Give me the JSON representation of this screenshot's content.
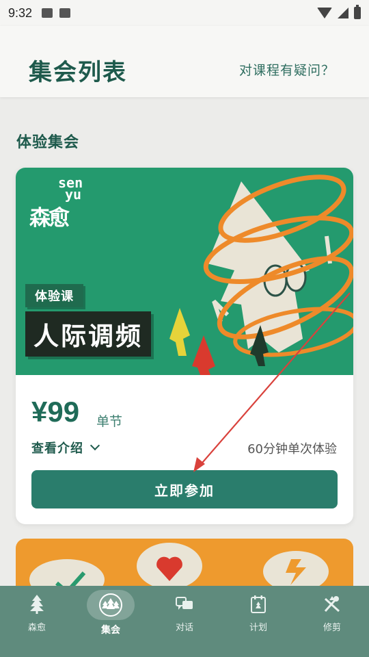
{
  "status_bar": {
    "time": "9:32"
  },
  "header": {
    "title": "集会列表",
    "help_link": "对课程有疑问？"
  },
  "section": {
    "title": "体验集会"
  },
  "card": {
    "logo_latin_1": "sen",
    "logo_latin_2": "yu",
    "logo_cn": "森愈",
    "tag_small": "体验课",
    "tag_big": "人际调频",
    "price": "¥99",
    "unit": "单节",
    "intro_link": "查看介绍",
    "duration": "60分钟单次体验",
    "join_button": "立即参加"
  },
  "nav": {
    "items": [
      {
        "label": "森愈",
        "icon": "tree-icon"
      },
      {
        "label": "集会",
        "icon": "forest-circle-icon"
      },
      {
        "label": "对话",
        "icon": "chat-icon"
      },
      {
        "label": "计划",
        "icon": "plan-icon"
      },
      {
        "label": "修剪",
        "icon": "pruning-icon"
      }
    ]
  },
  "colors": {
    "primary": "#2a7d6c",
    "banner_green": "#249a6e",
    "nav_bg": "#5f8b7d",
    "orange": "#ee9a2e",
    "annotation_red": "#d9423c"
  }
}
